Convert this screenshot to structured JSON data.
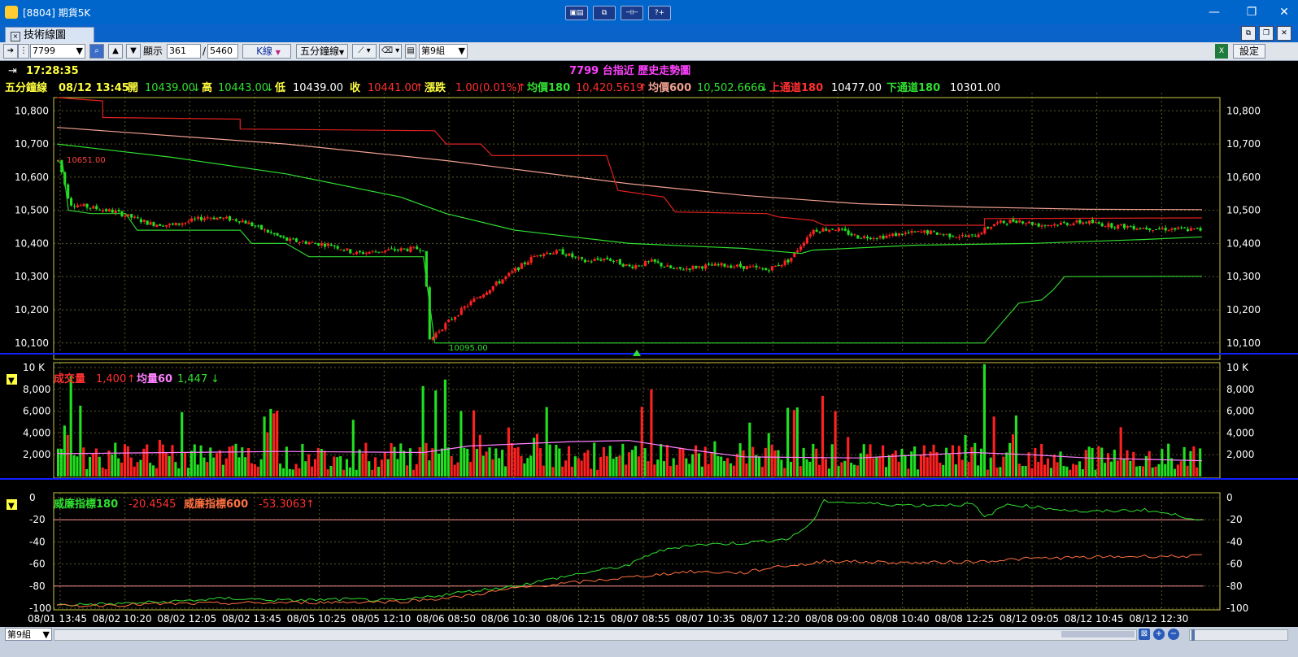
{
  "window": {
    "title": "[8804] 期貨5K",
    "center_buttons": [
      "▣▤",
      "⧉",
      "⊣⊢",
      "?+"
    ],
    "controls": [
      "—",
      "❐",
      "✕"
    ]
  },
  "tab": {
    "label": "技術線圖",
    "close": "×"
  },
  "toolbar": {
    "symbol": "7799",
    "display_label": "顯示",
    "display_count": "361",
    "slash": "/",
    "total_count": "5460",
    "chart_type": "K線",
    "period": "五分鐘線",
    "group": "第9組",
    "settings": "設定"
  },
  "chart_header": {
    "time": "17:28:35",
    "title": "7799 台指近  歷史走勢圖",
    "period": "五分鐘線",
    "datetime": "08/12 13:45",
    "open_label": "開",
    "open": "10439.00",
    "high_label": "高",
    "high": "10443.00",
    "low_label": "低",
    "low": "10439.00",
    "close_label": "收",
    "close": "10441.00",
    "change_label": "漲跌",
    "change": "1.00(0.01%)",
    "ma180_label": "均價180",
    "ma180": "10,420.5619",
    "ma600_label": "均價600",
    "ma600": "10,502.6666",
    "upper_label": "上通道180",
    "upper": "10477.00",
    "lower_label": "下通道180",
    "lower": "10301.00",
    "up_arrow": "↑",
    "down_arrow": "↓",
    "high_mark": "10651.00",
    "low_mark": "10095.00"
  },
  "volume_header": {
    "label": "成交量",
    "value": "1,400",
    "ma_label": "均量60",
    "ma_value": "1,447",
    "up_arrow": "↑",
    "down_arrow": "↓"
  },
  "williams_header": {
    "label180": "威廉指標180",
    "value180": "-20.4545",
    "label600": "威廉指標600",
    "value600": "-53.3063",
    "arrow": "↑"
  },
  "status": {
    "group": "第9組"
  },
  "colors": {
    "up": "#ff2020",
    "down": "#20e020",
    "ma180": "#30e030",
    "ma600": "#f0a090",
    "upper": "#e02020",
    "lower": "#30d030",
    "vol_ma": "#ff80ff",
    "grid": "#5a5a2a",
    "axis": "#c8c840",
    "separator": "#1020ff"
  },
  "chart_data": [
    {
      "type": "candlestick",
      "title": "7799 台指近  歷史走勢圖",
      "y_ticks": [
        10100,
        10200,
        10300,
        10400,
        10500,
        10600,
        10700,
        10800
      ],
      "ylim": [
        10070,
        10840
      ],
      "x_tick_labels": [
        "08/01 13:45",
        "08/02 10:20",
        "08/02 12:05",
        "08/02 13:45",
        "08/05 10:25",
        "08/05 12:10",
        "08/06 08:50",
        "08/06 10:30",
        "08/06 12:15",
        "08/07 08:55",
        "08/07 10:35",
        "08/07 12:20",
        "08/08 09:00",
        "08/08 10:40",
        "08/08 12:25",
        "08/12 09:05",
        "08/12 10:45",
        "08/12 12:30"
      ],
      "close_path_anchors": [
        {
          "x": 0.0,
          "y": 10651
        },
        {
          "x": 0.01,
          "y": 10520
        },
        {
          "x": 0.05,
          "y": 10495
        },
        {
          "x": 0.08,
          "y": 10460
        },
        {
          "x": 0.1,
          "y": 10455
        },
        {
          "x": 0.13,
          "y": 10480
        },
        {
          "x": 0.16,
          "y": 10470
        },
        {
          "x": 0.18,
          "y": 10440
        },
        {
          "x": 0.2,
          "y": 10410
        },
        {
          "x": 0.24,
          "y": 10395
        },
        {
          "x": 0.26,
          "y": 10370
        },
        {
          "x": 0.29,
          "y": 10380
        },
        {
          "x": 0.32,
          "y": 10385
        },
        {
          "x": 0.325,
          "y": 10110
        },
        {
          "x": 0.34,
          "y": 10160
        },
        {
          "x": 0.36,
          "y": 10220
        },
        {
          "x": 0.38,
          "y": 10270
        },
        {
          "x": 0.4,
          "y": 10320
        },
        {
          "x": 0.42,
          "y": 10370
        },
        {
          "x": 0.44,
          "y": 10375
        },
        {
          "x": 0.46,
          "y": 10345
        },
        {
          "x": 0.48,
          "y": 10355
        },
        {
          "x": 0.5,
          "y": 10330
        },
        {
          "x": 0.52,
          "y": 10345
        },
        {
          "x": 0.54,
          "y": 10320
        },
        {
          "x": 0.56,
          "y": 10330
        },
        {
          "x": 0.58,
          "y": 10335
        },
        {
          "x": 0.6,
          "y": 10330
        },
        {
          "x": 0.62,
          "y": 10320
        },
        {
          "x": 0.64,
          "y": 10350
        },
        {
          "x": 0.66,
          "y": 10440
        },
        {
          "x": 0.68,
          "y": 10445
        },
        {
          "x": 0.7,
          "y": 10420
        },
        {
          "x": 0.72,
          "y": 10420
        },
        {
          "x": 0.74,
          "y": 10430
        },
        {
          "x": 0.76,
          "y": 10435
        },
        {
          "x": 0.78,
          "y": 10425
        },
        {
          "x": 0.8,
          "y": 10420
        },
        {
          "x": 0.82,
          "y": 10460
        },
        {
          "x": 0.84,
          "y": 10470
        },
        {
          "x": 0.86,
          "y": 10455
        },
        {
          "x": 0.88,
          "y": 10460
        },
        {
          "x": 0.9,
          "y": 10465
        },
        {
          "x": 0.92,
          "y": 10455
        },
        {
          "x": 0.94,
          "y": 10450
        },
        {
          "x": 0.96,
          "y": 10445
        },
        {
          "x": 1.0,
          "y": 10441
        }
      ],
      "series": [
        {
          "name": "均價180",
          "points": [
            [
              0,
              10700
            ],
            [
              0.1,
              10660
            ],
            [
              0.2,
              10610
            ],
            [
              0.3,
              10540
            ],
            [
              0.34,
              10490
            ],
            [
              0.4,
              10440
            ],
            [
              0.5,
              10400
            ],
            [
              0.6,
              10385
            ],
            [
              0.65,
              10370
            ],
            [
              0.66,
              10380
            ],
            [
              0.75,
              10395
            ],
            [
              0.85,
              10400
            ],
            [
              0.95,
              10412
            ],
            [
              1.0,
              10420
            ]
          ]
        },
        {
          "name": "均價600",
          "points": [
            [
              0,
              10750
            ],
            [
              0.2,
              10700
            ],
            [
              0.34,
              10650
            ],
            [
              0.5,
              10580
            ],
            [
              0.6,
              10545
            ],
            [
              0.7,
              10520
            ],
            [
              0.8,
              10510
            ],
            [
              0.9,
              10503
            ],
            [
              1.0,
              10502
            ]
          ]
        },
        {
          "name": "上通道180",
          "points": [
            [
              0,
              10840
            ],
            [
              0.04,
              10830
            ],
            [
              0.04,
              10780
            ],
            [
              0.16,
              10775
            ],
            [
              0.16,
              10745
            ],
            [
              0.33,
              10740
            ],
            [
              0.34,
              10700
            ],
            [
              0.37,
              10700
            ],
            [
              0.38,
              10665
            ],
            [
              0.48,
              10665
            ],
            [
              0.49,
              10560
            ],
            [
              0.53,
              10540
            ],
            [
              0.54,
              10495
            ],
            [
              0.62,
              10490
            ],
            [
              0.63,
              10480
            ],
            [
              0.66,
              10470
            ],
            [
              0.67,
              10455
            ],
            [
              0.81,
              10455
            ],
            [
              0.81,
              10475
            ],
            [
              1.0,
              10477
            ]
          ]
        },
        {
          "name": "下通道180",
          "points": [
            [
              0,
              10650
            ],
            [
              0.005,
              10640
            ],
            [
              0.01,
              10500
            ],
            [
              0.03,
              10490
            ],
            [
              0.06,
              10490
            ],
            [
              0.07,
              10440
            ],
            [
              0.16,
              10440
            ],
            [
              0.17,
              10400
            ],
            [
              0.2,
              10400
            ],
            [
              0.22,
              10360
            ],
            [
              0.32,
              10360
            ],
            [
              0.33,
              10100
            ],
            [
              0.81,
              10100
            ],
            [
              0.82,
              10140
            ],
            [
              0.83,
              10180
            ],
            [
              0.84,
              10220
            ],
            [
              0.86,
              10230
            ],
            [
              0.87,
              10260
            ],
            [
              0.88,
              10300
            ],
            [
              1.0,
              10301
            ]
          ]
        }
      ]
    },
    {
      "type": "bar",
      "title": "成交量",
      "y_ticks": [
        2000,
        4000,
        6000,
        8000,
        10000
      ],
      "y_tick_labels": [
        "2,000",
        "4,000",
        "6,000",
        "8,000",
        "10 K"
      ],
      "ylim": [
        0,
        10000
      ],
      "spikes": [
        {
          "x": 0.005,
          "value": 7000
        },
        {
          "x": 0.01,
          "value": 9200
        },
        {
          "x": 0.02,
          "value": 6500
        },
        {
          "x": 0.18,
          "value": 5500
        },
        {
          "x": 0.185,
          "value": 6200
        },
        {
          "x": 0.19,
          "value": 5800
        },
        {
          "x": 0.32,
          "value": 8300
        },
        {
          "x": 0.33,
          "value": 7900
        },
        {
          "x": 0.34,
          "value": 8900
        },
        {
          "x": 0.42,
          "value": 5800
        },
        {
          "x": 0.51,
          "value": 6400
        },
        {
          "x": 0.52,
          "value": 8000
        },
        {
          "x": 0.64,
          "value": 6300
        },
        {
          "x": 0.67,
          "value": 7400
        },
        {
          "x": 0.68,
          "value": 6000
        },
        {
          "x": 0.81,
          "value": 10300
        },
        {
          "x": 0.82,
          "value": 5500
        },
        {
          "x": 0.84,
          "value": 5600
        }
      ],
      "series": [
        {
          "name": "均量60",
          "points": [
            [
              0,
              2100
            ],
            [
              0.2,
              2300
            ],
            [
              0.32,
              2200
            ],
            [
              0.36,
              2800
            ],
            [
              0.45,
              3200
            ],
            [
              0.5,
              3300
            ],
            [
              0.55,
              2500
            ],
            [
              0.6,
              1800
            ],
            [
              0.7,
              1700
            ],
            [
              0.8,
              2200
            ],
            [
              0.85,
              2000
            ],
            [
              0.9,
              1700
            ],
            [
              1.0,
              1447
            ]
          ]
        }
      ]
    },
    {
      "type": "line",
      "title": "威廉指標",
      "y_ticks": [
        -100,
        -80,
        -60,
        -40,
        -20,
        0
      ],
      "ylim": [
        -100,
        0
      ],
      "reference_lines": [
        -20,
        -80
      ],
      "series": [
        {
          "name": "威廉指標180",
          "points": [
            [
              0,
              -97
            ],
            [
              0.05,
              -96
            ],
            [
              0.1,
              -94
            ],
            [
              0.15,
              -91
            ],
            [
              0.2,
              -93
            ],
            [
              0.25,
              -92
            ],
            [
              0.3,
              -93
            ],
            [
              0.35,
              -86
            ],
            [
              0.4,
              -80
            ],
            [
              0.45,
              -70
            ],
            [
              0.5,
              -61
            ],
            [
              0.52,
              -50
            ],
            [
              0.55,
              -43
            ],
            [
              0.6,
              -41
            ],
            [
              0.64,
              -37
            ],
            [
              0.66,
              -22
            ],
            [
              0.67,
              -3
            ],
            [
              0.7,
              -5
            ],
            [
              0.75,
              -7
            ],
            [
              0.8,
              -6
            ],
            [
              0.81,
              -18
            ],
            [
              0.83,
              -6
            ],
            [
              0.86,
              -9
            ],
            [
              0.9,
              -13
            ],
            [
              0.95,
              -11
            ],
            [
              1.0,
              -20
            ]
          ]
        },
        {
          "name": "威廉指標600",
          "points": [
            [
              0,
              -98
            ],
            [
              0.1,
              -96
            ],
            [
              0.2,
              -95
            ],
            [
              0.3,
              -94
            ],
            [
              0.35,
              -90
            ],
            [
              0.4,
              -82
            ],
            [
              0.45,
              -77
            ],
            [
              0.5,
              -72
            ],
            [
              0.55,
              -67
            ],
            [
              0.6,
              -68
            ],
            [
              0.63,
              -62
            ],
            [
              0.66,
              -60
            ],
            [
              0.67,
              -57
            ],
            [
              0.7,
              -58
            ],
            [
              0.75,
              -59
            ],
            [
              0.8,
              -58
            ],
            [
              0.85,
              -55
            ],
            [
              0.9,
              -54
            ],
            [
              0.95,
              -53
            ],
            [
              1.0,
              -53
            ]
          ]
        }
      ]
    }
  ]
}
